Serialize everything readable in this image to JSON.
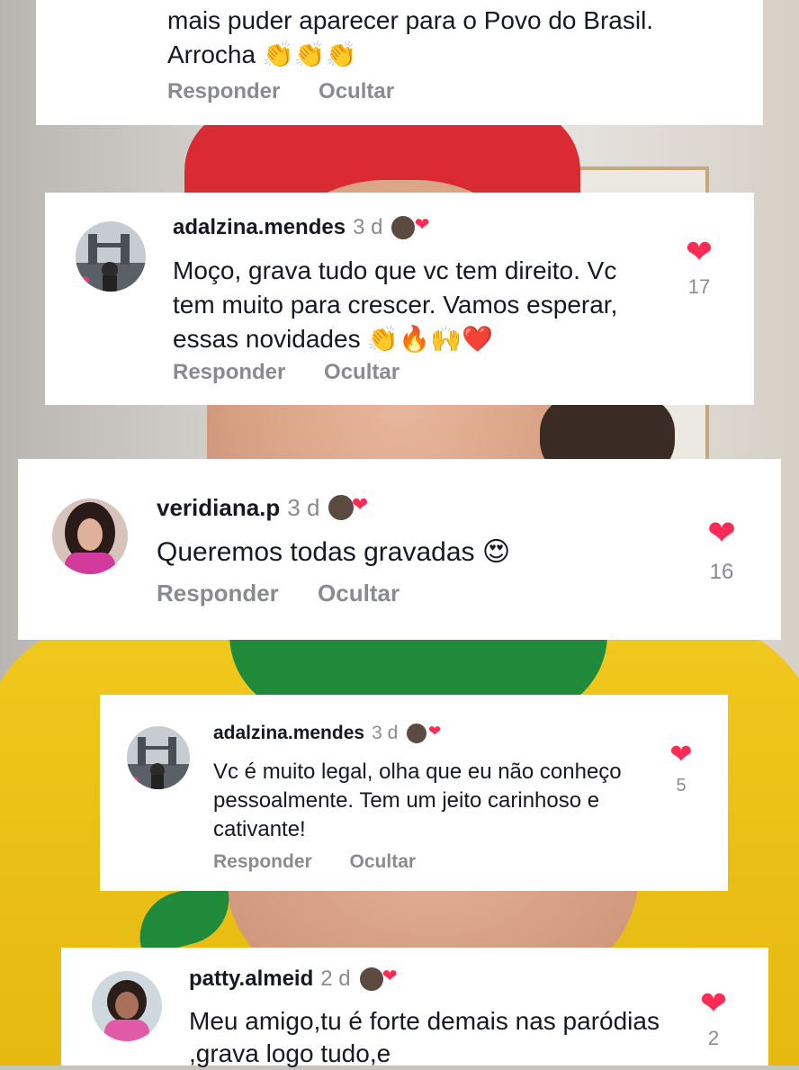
{
  "comments": [
    {
      "text": "mais puder aparecer para o Povo do Brasil. Arrocha 👏👏👏",
      "reply_label": "Responder",
      "hide_label": "Ocultar"
    },
    {
      "username": "adalzina.mendes",
      "age": "3 d",
      "text": "Moço, grava tudo que vc tem direito. Vc tem muito para crescer. Vamos esperar, essas novidades 👏🔥🙌❤️",
      "reply_label": "Responder",
      "hide_label": "Ocultar",
      "likes": "17"
    },
    {
      "username": "veridiana.p",
      "age": "3 d",
      "text": "Queremos todas gravadas 😍",
      "reply_label": "Responder",
      "hide_label": "Ocultar",
      "likes": "16"
    },
    {
      "username": "adalzina.mendes",
      "age": "3 d",
      "text": "Vc é muito legal, olha que eu não conheço pessoalmente. Tem um jeito carinhoso e cativante!",
      "reply_label": "Responder",
      "hide_label": "Ocultar",
      "likes": "5"
    },
    {
      "username": "patty.almeid",
      "age": "2 d",
      "text": "Meu amigo,tu é forte demais nas paródias ,grava logo tudo,e",
      "likes": "2"
    }
  ],
  "icons": {
    "heart": "heart-icon",
    "creator_liked": "creator-liked-badge-icon"
  },
  "colors": {
    "like_red": "#fe2c55",
    "username": "#161823",
    "muted": "#8a8b91"
  }
}
